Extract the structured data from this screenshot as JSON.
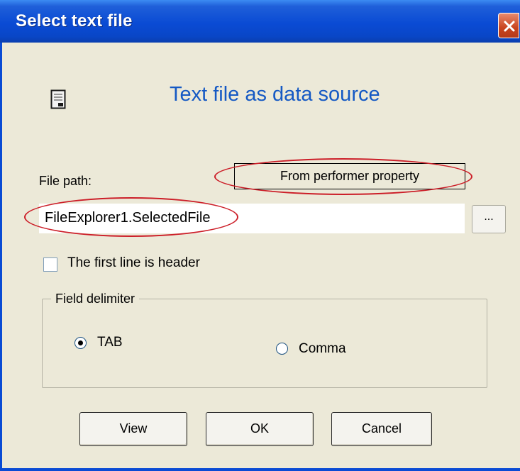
{
  "window": {
    "title": "Select text file"
  },
  "header": {
    "heading": "Text file as data source",
    "icon": "text-document-icon"
  },
  "file_path": {
    "label": "File path:",
    "from_property_label": "From performer property",
    "value": "FileExplorer1.SelectedFile",
    "browse_label": "..."
  },
  "options": {
    "first_line_header_label": "The first line is header",
    "first_line_header_checked": false
  },
  "delimiter": {
    "legend": "Field delimiter",
    "options": [
      {
        "label": "TAB",
        "selected": true
      },
      {
        "label": "Comma",
        "selected": false
      }
    ]
  },
  "footer": {
    "view_label": "View",
    "ok_label": "OK",
    "cancel_label": "Cancel"
  },
  "colors": {
    "title_bar": "#0A4BD4",
    "heading": "#1559C4",
    "dialog_bg": "#ECE9D8",
    "annotation": "#CC1E28",
    "close_button": "#C9441E"
  }
}
